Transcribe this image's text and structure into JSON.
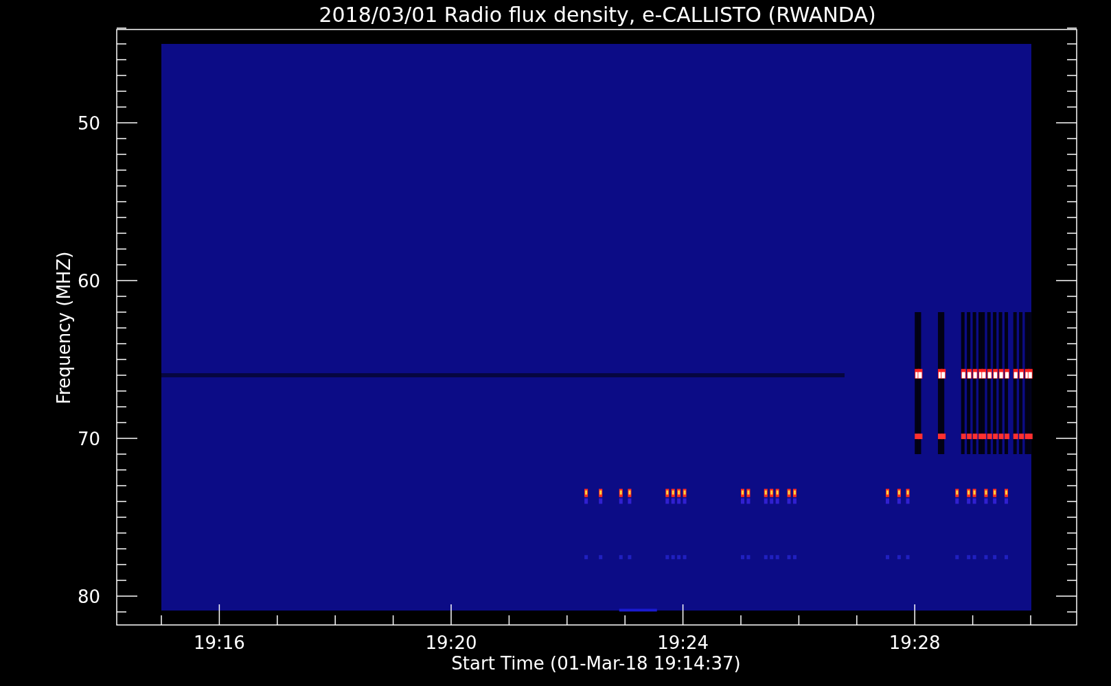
{
  "plot": {
    "title": "2018/03/01  Radio flux density, e-CALLISTO (RWANDA)",
    "xlabel": "Start Time (01-Mar-18 19:14:37)",
    "ylabel": "Frequency (MHZ)",
    "yticks": [
      "50",
      "60",
      "70",
      "80"
    ],
    "xticks": [
      "19:16",
      "19:20",
      "19:24",
      "19:28"
    ]
  }
}
